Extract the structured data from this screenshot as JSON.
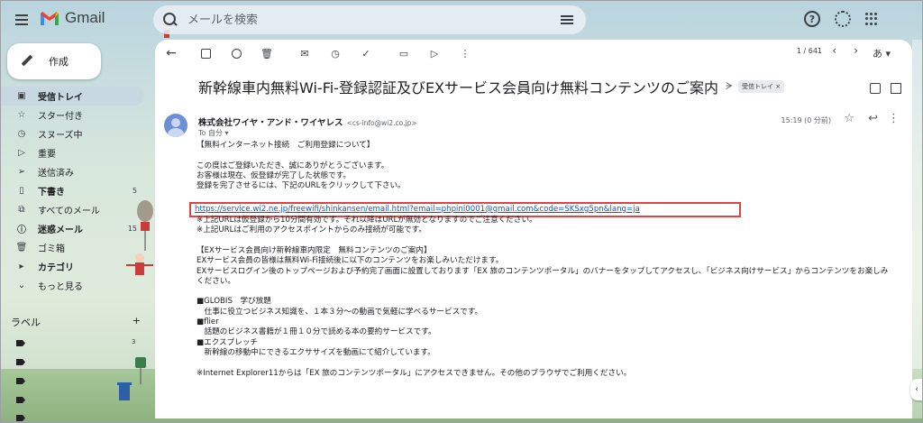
{
  "app": {
    "name": "Gmail",
    "colors": {
      "accent": "#1a57c4",
      "highlight_box": "#e04343",
      "active_nav": "#c8d7e1"
    }
  },
  "search": {
    "placeholder": "メールを検索"
  },
  "sidebar": {
    "compose_label": "作成",
    "items": [
      {
        "icon": "inbox-icon",
        "label": "受信トレイ",
        "count": "",
        "active": true,
        "bold": true
      },
      {
        "icon": "star-icon",
        "label": "スター付き",
        "count": ""
      },
      {
        "icon": "clock-icon",
        "label": "スヌーズ中",
        "count": ""
      },
      {
        "icon": "important-icon",
        "label": "重要",
        "count": ""
      },
      {
        "icon": "send-icon",
        "label": "送信済み",
        "count": ""
      },
      {
        "icon": "draft-icon",
        "label": "下書き",
        "count": "5",
        "bold": true
      },
      {
        "icon": "all-mail-icon",
        "label": "すべてのメール",
        "count": ""
      },
      {
        "icon": "spam-icon",
        "label": "迷惑メール",
        "count": "15",
        "bold": true
      },
      {
        "icon": "trash-icon",
        "label": "ゴミ箱",
        "count": ""
      },
      {
        "icon": "category-icon",
        "label": "カテゴリ",
        "count": "",
        "bold": true
      },
      {
        "icon": "chevron-down-icon",
        "label": "もっと見る",
        "count": ""
      }
    ],
    "labels_title": "ラベル",
    "labels": [
      {
        "count": "3"
      },
      {
        "count": ""
      },
      {
        "count": ""
      },
      {
        "count": ""
      },
      {
        "count": ""
      }
    ]
  },
  "toolbar": {
    "pager": "1 / 641",
    "lang": "あ"
  },
  "message": {
    "subject": "新幹線車内無料Wi-Fi-登録認証及びEXサービス会員向け無料コンテンツのご案内",
    "inbox_chip": "受信トレイ ×",
    "sender_name": "株式会社ワイヤ・アンド・ワイヤレス",
    "sender_email": "<cs-info@wi2.co.jp>",
    "to": "To 自分 ▾",
    "time": "15:19 (0 分前)",
    "body_top": [
      "【無料インターネット接続　ご利用登録について】",
      "",
      "この度はご登録いただき、誠にありがとうございます。",
      "お客様は現在、仮登録が完了した状態です。",
      "登録を完了させるには、下記のURLをクリックして下さい。",
      ""
    ],
    "link": "https://service.wi2.ne.jp/freewifi/shinkansen/email.html?email=phpini0001@gmail.com&code=SKSxg5pn&lang=ja",
    "body_bottom": [
      "※上記URLは仮登録から10分間有効です。それ以降はURLが無効となりますのでご注意ください。",
      "※上記URLはご利用のアクセスポイントからのみ接続が可能です。",
      "",
      "【EXサービス会員向け新幹線車内限定　無料コンテンツのご案内】",
      "EXサービス会員の皆様は無料Wi-Fi接続後に以下のコンテンツをお楽しみいただけます。",
      "EXサービスログイン後のトップページおよび予約完了画面に設置しております「EX 旅のコンテンツポータル」のバナーをタップしてアクセスし、「ビジネス向けサービス」からコンテンツをお楽しみ",
      "ください。",
      "",
      "■GLOBIS　学び放題",
      "　仕事に役立つビジネス知識を、１本３分～の動画で気軽に学べるサービスです。",
      "■flier",
      "　話題のビジネス書籍が１冊１０分で読める本の要約サービスです。",
      "■エクスプレッチ",
      "　新幹線の移動中にできるエクササイズを動画にて紹介しています。",
      "",
      "※Internet Explorer11からは「EX 旅のコンテンツポータル」にアクセスできません。その他のブラウザでご利用ください。"
    ]
  }
}
